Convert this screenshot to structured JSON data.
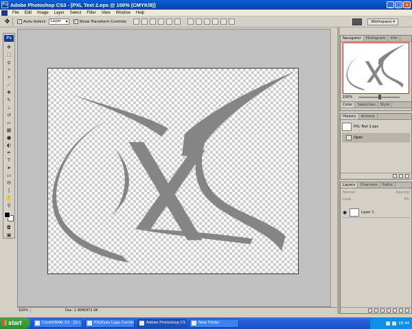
{
  "window": {
    "title": "Adobe Photoshop CS3 - [PXL Text  2.eps @ 100% (CMYK/8)]",
    "logo": "Ps"
  },
  "menu": [
    "File",
    "Edit",
    "Image",
    "Layer",
    "Select",
    "Filter",
    "View",
    "Window",
    "Help"
  ],
  "options": {
    "auto_select_label": "Auto-Select:",
    "auto_select_value": "Layer",
    "transform_label": "Show Transform Controls",
    "workspace": "Workspace ▾"
  },
  "toolbox": {
    "logo": "Ps",
    "tools": [
      "move-icon",
      "marquee-icon",
      "lasso-icon",
      "wand-icon",
      "crop-icon",
      "slice-icon",
      "healing-icon",
      "brush-icon",
      "stamp-icon",
      "history-brush-icon",
      "eraser-icon",
      "gradient-icon",
      "blur-icon",
      "dodge-icon",
      "pen-icon",
      "type-icon",
      "path-select-icon",
      "shape-icon",
      "notes-icon",
      "eyedropper-icon",
      "hand-icon",
      "zoom-icon"
    ]
  },
  "document": {
    "zoom": "100%",
    "info": "Doc: 1.90M/972.0K",
    "logo_color": "#858585"
  },
  "navigator": {
    "tabs": [
      "Navigator",
      "Histogram",
      "Info"
    ],
    "zoom": "100%"
  },
  "color_panel": {
    "tabs": [
      "Color",
      "Swatches",
      "Style"
    ]
  },
  "history": {
    "tabs": [
      "History",
      "Actions"
    ],
    "snapshot": "PXL Text  2.eps",
    "items": [
      "Open"
    ]
  },
  "layers": {
    "tabs": [
      "Layers",
      "Channels",
      "Paths"
    ],
    "mode": "Normal",
    "opacity_label": "Opacity:",
    "lock_label": "Lock:",
    "fill_label": "Fill:",
    "layer_name": "Layer 1"
  },
  "taskbar": {
    "start": "start",
    "tasks": [
      "CorelDRAW X3 - [D:\\...",
      "PXLEyes Logo Contest...",
      "Adobe Photoshop CS...",
      "New Folder"
    ],
    "clock": "16:44"
  }
}
